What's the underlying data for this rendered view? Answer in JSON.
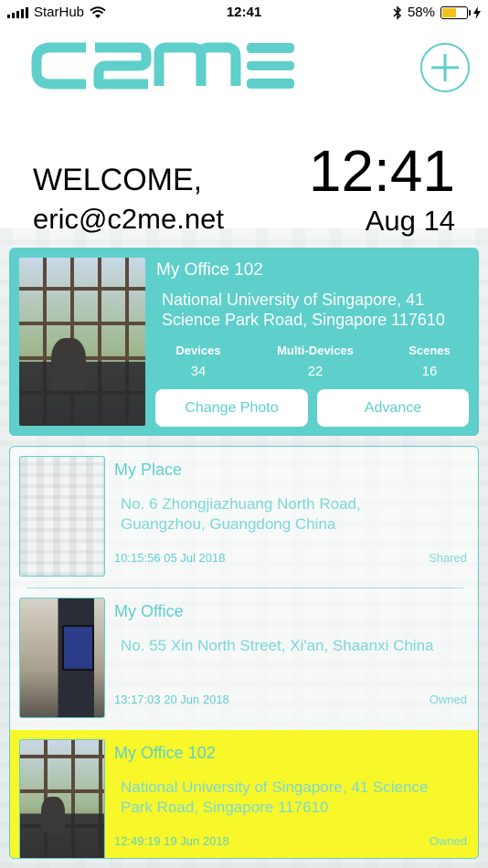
{
  "status_bar": {
    "carrier": "StarHub",
    "time": "12:41",
    "battery_percent": "58%",
    "battery_level": 0.58,
    "icons": [
      "signal-icon",
      "wifi-icon",
      "bluetooth-icon",
      "battery-icon",
      "charging-icon"
    ]
  },
  "brand": {
    "logo_text": "C2ME",
    "accent": "#5ecfcb",
    "highlight": "#f8f729"
  },
  "header": {
    "add_icon": "plus-icon",
    "welcome": "WELCOME,",
    "email": "eric@c2me.net",
    "clock": "12:41",
    "date": "Aug 14"
  },
  "current_place": {
    "name": "My Office 102",
    "address": "National University of Singapore, 41 Science Park Road, Singapore 117610",
    "stats": [
      {
        "label": "Devices",
        "value": "34"
      },
      {
        "label": "Multi-Devices",
        "value": "22"
      },
      {
        "label": "Scenes",
        "value": "16"
      }
    ],
    "change_photo_label": "Change Photo",
    "advance_label": "Advance"
  },
  "places": [
    {
      "name": "My Place",
      "address": "No. 6 Zhongjiazhuang North Road, Guangzhou, Guangdong China",
      "timestamp": "10:15:56 05 Jul 2018",
      "role": "Shared"
    },
    {
      "name": "My Office",
      "address": "No. 55 Xin North Street, Xi'an, Shaanxi China",
      "timestamp": "13:17:03 20 Jun 2018",
      "role": "Owned"
    },
    {
      "name": "My Office 102",
      "address": "National University of Singapore, 41 Science Park Road, Singapore 117610",
      "timestamp": "12:49:19 19 Jun 2018",
      "role": "Owned"
    }
  ]
}
